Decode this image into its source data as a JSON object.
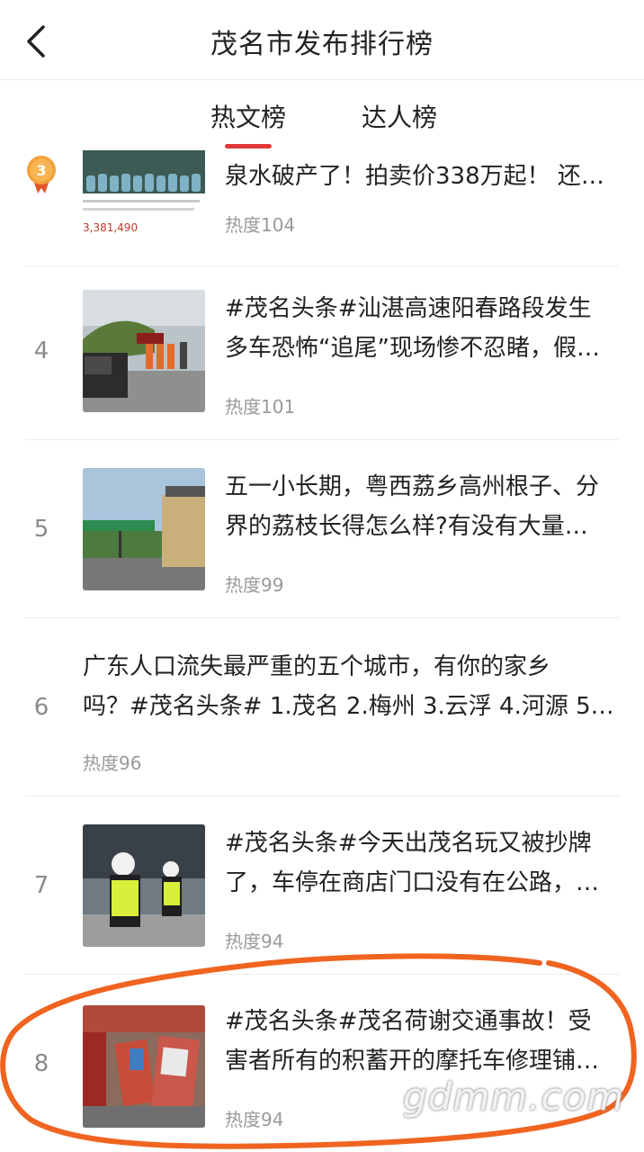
{
  "header": {
    "title": "茂名市发布排行榜"
  },
  "tabs": [
    {
      "label": "热文榜",
      "active": true
    },
    {
      "label": "达人榜",
      "active": false
    }
  ],
  "accent_color": "#e4393c",
  "items": [
    {
      "rank": "3",
      "title_line1": "泉水破产了！拍卖价338万起！ 还…",
      "heat": "热度104",
      "thumb_number": "3,381,490"
    },
    {
      "rank": "4",
      "title_line1": "#茂名头条#汕湛高速阳春路段发生",
      "title_line2": "多车恐怖“追尾”现场惨不忍睹，假…",
      "heat": "热度101"
    },
    {
      "rank": "5",
      "title_line1": "五一小长期，粤西荔乡高州根子、分",
      "title_line2": "界的荔枝长得怎么样?有没有大量…",
      "heat": "热度99"
    },
    {
      "rank": "6",
      "title_line1": "广东人口流失最严重的五个城市，有你的家乡",
      "title_line2": "吗？#茂名头条# 1.茂名 2.梅州 3.云浮 4.河源 5.…",
      "heat": "热度96"
    },
    {
      "rank": "7",
      "title_line1": "#茂名头条#今天出茂名玩又被抄牌",
      "title_line2": "了，车停在商店门口没有在公路，…",
      "heat": "热度94"
    },
    {
      "rank": "8",
      "title_line1": "#茂名头条#茂名荷谢交通事故！受",
      "title_line2": "害者所有的积蓄开的摩托车修理铺…",
      "heat": "热度94"
    }
  ],
  "watermark": "gdmm.com"
}
